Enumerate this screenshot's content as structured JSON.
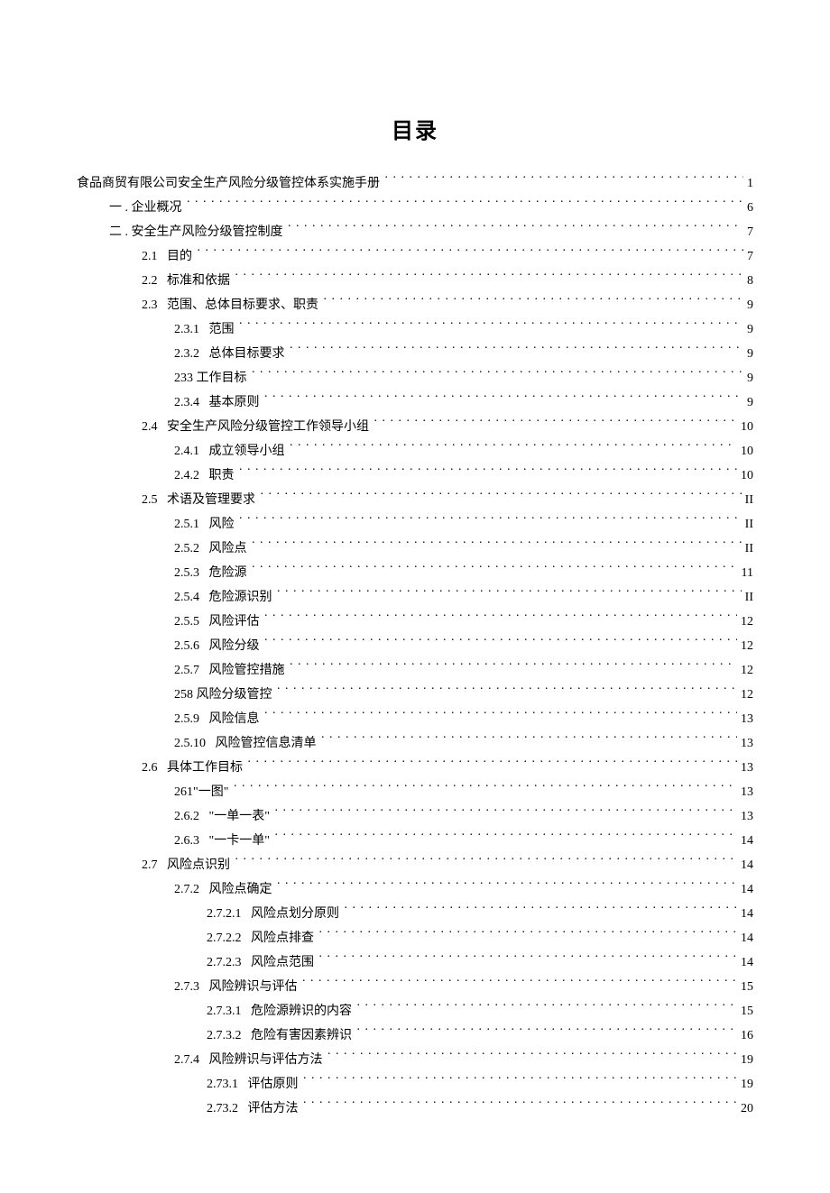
{
  "title": "目录",
  "indentUnit": 36,
  "baseIndent": 0,
  "entries": [
    {
      "indent": 0,
      "label": "食品商贸有限公司安全生产风险分级管控体系实施手册",
      "page": "1"
    },
    {
      "indent": 1,
      "label": "一 . 企业概况",
      "page": "6"
    },
    {
      "indent": 1,
      "label": "二 . 安全生产风险分级管控制度",
      "page": "7"
    },
    {
      "indent": 2,
      "label": "2.1   目的",
      "page": "7"
    },
    {
      "indent": 2,
      "label": "2.2   标准和依据",
      "page": "8"
    },
    {
      "indent": 2,
      "label": "2.3   范围、总体目标要求、职责",
      "page": "9"
    },
    {
      "indent": 3,
      "label": "2.3.1   范围",
      "page": "9"
    },
    {
      "indent": 3,
      "label": "2.3.2   总体目标要求",
      "page": "9"
    },
    {
      "indent": 3,
      "label": "233 工作目标",
      "page": "9"
    },
    {
      "indent": 3,
      "label": "2.3.4   基本原则",
      "page": "9"
    },
    {
      "indent": 2,
      "label": "2.4   安全生产风险分级管控工作领导小组",
      "page": "10"
    },
    {
      "indent": 3,
      "label": "2.4.1   成立领导小组",
      "page": "10"
    },
    {
      "indent": 3,
      "label": "2.4.2   职责",
      "page": "10"
    },
    {
      "indent": 2,
      "label": "2.5   术语及管理要求",
      "page": "II"
    },
    {
      "indent": 3,
      "label": "2.5.1   风险",
      "page": "II"
    },
    {
      "indent": 3,
      "label": "2.5.2   风险点",
      "page": "II"
    },
    {
      "indent": 3,
      "label": "2.5.3   危险源",
      "page": "11"
    },
    {
      "indent": 3,
      "label": "2.5.4   危险源识别",
      "page": "II"
    },
    {
      "indent": 3,
      "label": "2.5.5   风险评估",
      "page": "12"
    },
    {
      "indent": 3,
      "label": "2.5.6   风险分级",
      "page": "12"
    },
    {
      "indent": 3,
      "label": "2.5.7   风险管控措施",
      "page": "12"
    },
    {
      "indent": 3,
      "label": "258 风险分级管控",
      "page": "12"
    },
    {
      "indent": 3,
      "label": "2.5.9   风险信息",
      "page": "13"
    },
    {
      "indent": 3,
      "label": "2.5.10   风险管控信息清单",
      "page": "13"
    },
    {
      "indent": 2,
      "label": "2.6   具体工作目标",
      "page": "13"
    },
    {
      "indent": 3,
      "label": "261\"一图\"",
      "page": "13"
    },
    {
      "indent": 3,
      "label": "2.6.2   \"一单一表\"",
      "page": "13"
    },
    {
      "indent": 3,
      "label": "2.6.3   \"一卡一单\"",
      "page": "14"
    },
    {
      "indent": 2,
      "label": "2.7   风险点识别",
      "page": "14"
    },
    {
      "indent": 3,
      "label": "2.7.2   风险点确定",
      "page": "14"
    },
    {
      "indent": 4,
      "label": "2.7.2.1   风险点划分原则",
      "page": "14"
    },
    {
      "indent": 4,
      "label": "2.7.2.2   风险点排查",
      "page": "14"
    },
    {
      "indent": 4,
      "label": "2.7.2.3   风险点范围",
      "page": "14"
    },
    {
      "indent": 3,
      "label": "2.7.3   风险辨识与评估",
      "page": "15"
    },
    {
      "indent": 4,
      "label": "2.7.3.1   危险源辨识的内容",
      "page": "15"
    },
    {
      "indent": 4,
      "label": "2.7.3.2   危险有害因素辨识",
      "page": "16"
    },
    {
      "indent": 3,
      "label": "2.7.4   风险辨识与评估方法",
      "page": "19"
    },
    {
      "indent": 4,
      "label": "2.73.1   评估原则",
      "page": "19"
    },
    {
      "indent": 4,
      "label": "2.73.2   评估方法",
      "page": "20"
    }
  ]
}
